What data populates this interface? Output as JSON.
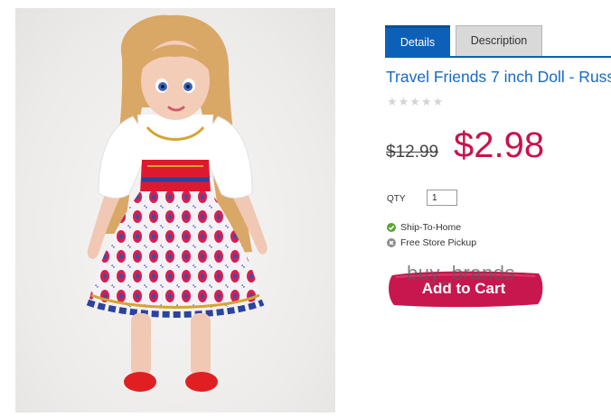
{
  "tabs": [
    {
      "label": "Details",
      "active": true
    },
    {
      "label": "Description",
      "active": false
    }
  ],
  "product": {
    "title": "Travel Friends 7 inch Doll - Russ",
    "rating_stars": "★★★★★",
    "old_price": "$12.99",
    "price": "$2.98"
  },
  "qty": {
    "label": "QTY",
    "value": "1"
  },
  "fulfillment": [
    {
      "label": "Ship-To-Home",
      "available": true
    },
    {
      "label": "Free Store Pickup",
      "available": false
    }
  ],
  "cart": {
    "label": "Add to Cart"
  },
  "watermark": "buy_brands",
  "colors": {
    "accent_blue": "#0d60b8",
    "link_blue": "#1769c3",
    "price_red": "#c9124b",
    "cart_red": "#c8174f"
  }
}
